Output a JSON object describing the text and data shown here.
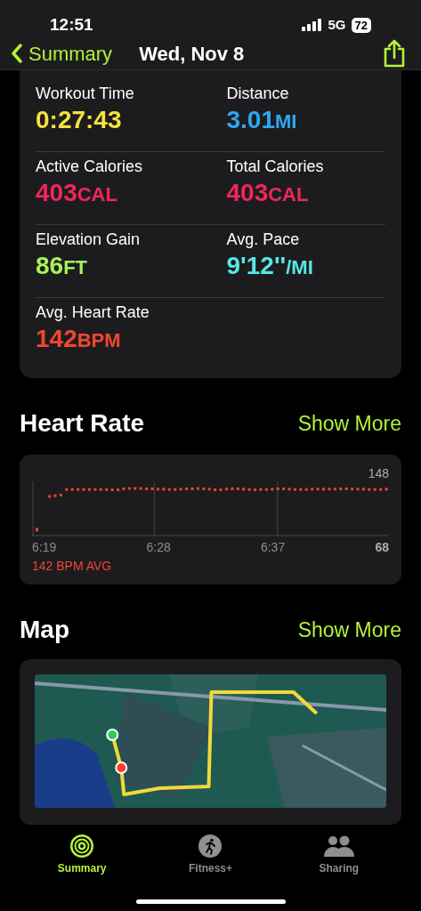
{
  "status_bar": {
    "time": "12:51",
    "network": "5G",
    "battery": "72"
  },
  "nav": {
    "back": "Summary",
    "title": "Wed, Nov 8"
  },
  "stats": [
    {
      "label": "Workout Time",
      "value": "0:27:43",
      "color": "#f5e23a"
    },
    {
      "label": "Distance",
      "value": "3.01",
      "unit": "MI",
      "color": "#2ea8f2"
    },
    {
      "label": "Active Calories",
      "value": "403",
      "unit": "CAL",
      "color": "#f0265a"
    },
    {
      "label": "Total Calories",
      "value": "403",
      "unit": "CAL",
      "color": "#f0265a"
    },
    {
      "label": "Elevation Gain",
      "value": "86",
      "unit": "FT",
      "color": "#a6f25a"
    },
    {
      "label": "Avg. Pace",
      "value": "9'12''",
      "unit": "/MI",
      "color": "#5ae6e6"
    },
    {
      "label": "Avg. Heart Rate",
      "value": "142",
      "unit": "BPM",
      "color": "#f2462e"
    }
  ],
  "heart_rate": {
    "title": "Heart Rate",
    "action": "Show More",
    "max_label": "148",
    "min_label": "68",
    "times": [
      "6:19",
      "6:28",
      "6:37"
    ],
    "average": "142 BPM AVG"
  },
  "map": {
    "title": "Map",
    "action": "Show More",
    "kind": "picture"
  },
  "tabs": [
    {
      "label": "Summary",
      "selected": true
    },
    {
      "label": "Fitness+",
      "selected": false
    },
    {
      "label": "Sharing",
      "selected": false
    }
  ]
}
